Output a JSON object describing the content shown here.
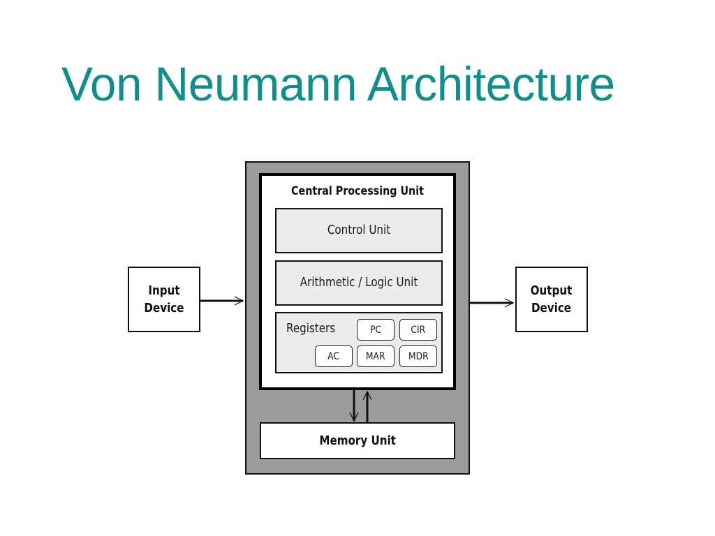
{
  "title": "Von Neumann Architecture",
  "colors": {
    "title": "#0e8f8c",
    "outer_fill": "#9b9b9b",
    "unit_fill": "#ececec",
    "stroke": "#111111"
  },
  "diagram": {
    "input_device": {
      "line1": "Input",
      "line2": "Device"
    },
    "output_device": {
      "line1": "Output",
      "line2": "Device"
    },
    "cpu": {
      "title": "Central Processing Unit",
      "control_unit": "Control Unit",
      "alu": "Arithmetic / Logic Unit",
      "registers": {
        "label": "Registers",
        "items": [
          "PC",
          "CIR",
          "AC",
          "MAR",
          "MDR"
        ]
      }
    },
    "memory_unit": "Memory Unit",
    "connections": [
      {
        "from": "Input Device",
        "to": "Central Processing Unit",
        "direction": "right"
      },
      {
        "from": "Central Processing Unit",
        "to": "Output Device",
        "direction": "right"
      },
      {
        "from": "Central Processing Unit",
        "to": "Memory Unit",
        "direction": "down"
      },
      {
        "from": "Memory Unit",
        "to": "Central Processing Unit",
        "direction": "up"
      }
    ]
  }
}
